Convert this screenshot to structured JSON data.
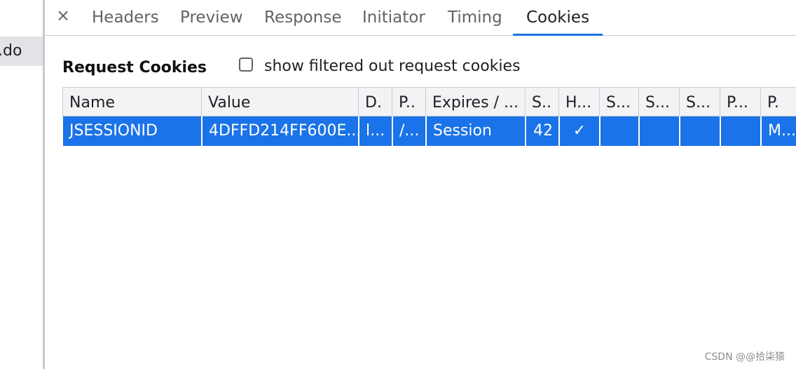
{
  "left_pane": {
    "selected_request_label": ".do"
  },
  "tabs": {
    "close_icon": "×",
    "items": [
      "Headers",
      "Preview",
      "Response",
      "Initiator",
      "Timing",
      "Cookies"
    ],
    "active": "Cookies"
  },
  "request_cookies": {
    "title": "Request Cookies",
    "filter_checkbox_label": "show filtered out request cookies",
    "filter_checked": false
  },
  "table": {
    "columns": [
      "Name",
      "Value",
      "D.",
      "P..",
      "Expires / ...",
      "S..",
      "H...",
      "S...",
      "S...",
      "S...",
      "P...",
      "P."
    ],
    "rows": [
      [
        "JSESSIONID",
        "4DFFD214FF600E...",
        "l...",
        "/...",
        "Session",
        "42",
        "✓",
        "",
        "",
        "",
        "",
        "M..."
      ]
    ],
    "selected_row_color": "#1a73e8"
  },
  "watermark": "CSDN @@拾柒猿"
}
